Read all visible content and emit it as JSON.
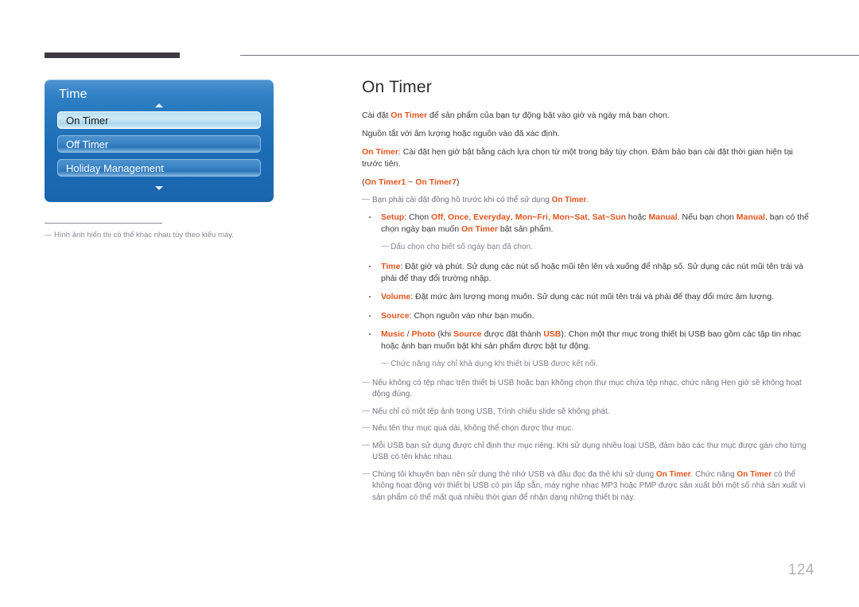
{
  "page": {
    "number": "124",
    "heading": "On Timer"
  },
  "osd": {
    "title": "Time",
    "up_arrow_icon": "chevron-up-icon",
    "down_arrow_icon": "chevron-down-icon",
    "items": [
      {
        "label": "On Timer",
        "selected": true
      },
      {
        "label": "Off Timer",
        "selected": false
      },
      {
        "label": "Holiday Management",
        "selected": false
      }
    ],
    "caption": {
      "dash": "—",
      "text": "Hình ảnh hiển thị có thể khác nhau tùy theo kiểu máy."
    }
  },
  "content": {
    "intro": [
      {
        "segments": [
          {
            "t": "Cài đặt ",
            "style": "plain"
          },
          {
            "t": "On Timer",
            "style": "orange"
          },
          {
            "t": " để sản phẩm của bạn tự động bật vào giờ và ngày mà bạn chọn.",
            "style": "plain"
          }
        ]
      },
      {
        "segments": [
          {
            "t": "Nguồn tắt với âm lượng hoặc nguồn vào đã xác định.",
            "style": "plain"
          }
        ]
      },
      {
        "segments": [
          {
            "t": "On Timer",
            "style": "orange"
          },
          {
            "t": ": Cài đặt hẹn giờ bật bằng cách lựa chọn từ một trong bảy tùy chọn. Đảm bảo bạn cài đặt thời gian hiện tại trước tiên.",
            "style": "plain"
          }
        ]
      },
      {
        "segments": [
          {
            "t": "(",
            "style": "plain"
          },
          {
            "t": "On Timer1",
            "style": "orange"
          },
          {
            "t": " ~ ",
            "style": "plain"
          },
          {
            "t": "On Timer7",
            "style": "orange"
          },
          {
            "t": ")",
            "style": "plain"
          }
        ]
      }
    ],
    "note_clock": {
      "dash": "—",
      "segments": [
        {
          "t": "Bạn phải cài đặt đồng hồ trước khi có thể sử dụng ",
          "style": "plain"
        },
        {
          "t": "On Timer",
          "style": "orange"
        },
        {
          "t": ".",
          "style": "plain"
        }
      ]
    },
    "bullets": [
      {
        "name": "bullet-setup",
        "segments": [
          {
            "t": "Setup",
            "style": "orange"
          },
          {
            "t": ": Chọn ",
            "style": "plain"
          },
          {
            "t": "Off",
            "style": "orange"
          },
          {
            "t": ", ",
            "style": "plain"
          },
          {
            "t": "Once",
            "style": "orange"
          },
          {
            "t": ", ",
            "style": "plain"
          },
          {
            "t": "Everyday",
            "style": "orange"
          },
          {
            "t": ", ",
            "style": "plain"
          },
          {
            "t": "Mon~Fri",
            "style": "orange"
          },
          {
            "t": ", ",
            "style": "plain"
          },
          {
            "t": "Mon~Sat",
            "style": "orange"
          },
          {
            "t": ", ",
            "style": "plain"
          },
          {
            "t": "Sat~Sun",
            "style": "orange"
          },
          {
            "t": " hoặc ",
            "style": "plain"
          },
          {
            "t": "Manual",
            "style": "orange"
          },
          {
            "t": ". Nếu bạn chọn ",
            "style": "plain"
          },
          {
            "t": "Manual",
            "style": "orange"
          },
          {
            "t": ", bạn có thể chọn ngày bạn muốn ",
            "style": "plain"
          },
          {
            "t": "On Timer",
            "style": "orange"
          },
          {
            "t": " bật sản phẩm.",
            "style": "plain"
          }
        ],
        "sub_note": {
          "dash": "—",
          "text": "Dấu chọn cho biết số ngày bạn đã chọn."
        }
      },
      {
        "name": "bullet-time",
        "segments": [
          {
            "t": "Time",
            "style": "orange"
          },
          {
            "t": ": Đặt giờ và phút. Sử dụng các nút số hoặc mũi tên lên và xuống để nhập số. Sử dụng các nút mũi tên trái và phải để thay đổi trường nhập.",
            "style": "plain"
          }
        ]
      },
      {
        "name": "bullet-volume",
        "segments": [
          {
            "t": "Volume",
            "style": "orange"
          },
          {
            "t": ": Đặt mức âm lượng mong muốn. Sử dụng các nút mũi tên trái và phải để thay đổi mức âm lượng.",
            "style": "plain"
          }
        ]
      },
      {
        "name": "bullet-source",
        "segments": [
          {
            "t": "Source",
            "style": "orange"
          },
          {
            "t": ": Chọn nguồn vào như bạn muốn.",
            "style": "plain"
          }
        ]
      },
      {
        "name": "bullet-music-photo",
        "segments": [
          {
            "t": "Music",
            "style": "orange"
          },
          {
            "t": " / ",
            "style": "plain"
          },
          {
            "t": "Photo",
            "style": "orange"
          },
          {
            "t": " (khi ",
            "style": "plain"
          },
          {
            "t": "Source",
            "style": "orange"
          },
          {
            "t": " được đặt thành ",
            "style": "plain"
          },
          {
            "t": "USB",
            "style": "orange"
          },
          {
            "t": "): Chọn một thư mục trong thiết bị USB bao gồm các tập tin nhạc hoặc ảnh bạn muốn bật khi sản phẩm được bật tự động.",
            "style": "plain"
          }
        ],
        "sub_note": {
          "dash": "—",
          "text": "Chức năng này chỉ khả dụng khi thiết bị USB được kết nối."
        }
      }
    ],
    "footer_notes": [
      {
        "name": "note-no-music-file",
        "dash": "—",
        "segments": [
          {
            "t": "Nếu không có tệp nhạc trên thiết bị USB hoặc bạn không chọn thư mục chứa tệp nhạc, chức năng Hẹn giờ sẽ không hoạt động đúng.",
            "style": "plain"
          }
        ]
      },
      {
        "name": "note-single-photo",
        "dash": "—",
        "segments": [
          {
            "t": "Nếu chỉ có một tệp ảnh trong USB, Trình chiếu slide sẽ không phát.",
            "style": "plain"
          }
        ]
      },
      {
        "name": "note-folder-name-long",
        "dash": "—",
        "segments": [
          {
            "t": "Nếu tên thư mục quá dài, không thể chọn được thư mục.",
            "style": "plain"
          }
        ]
      },
      {
        "name": "note-folder-per-usb",
        "dash": "—",
        "segments": [
          {
            "t": "Mỗi USB bạn sử dụng được chỉ định thư mục riêng. Khi sử dụng nhiều loại USB, đảm bảo các thư mục được gán cho từng USB có tên khác nhau.",
            "style": "plain"
          }
        ]
      },
      {
        "name": "note-memory-card",
        "dash": "—",
        "segments": [
          {
            "t": "Chúng tôi khuyên bạn nên sử dụng thẻ nhớ USB và đầu đọc đa thẻ khi sử dụng ",
            "style": "plain"
          },
          {
            "t": "On Timer",
            "style": "orange"
          },
          {
            "t": ". Chức năng ",
            "style": "plain"
          },
          {
            "t": "On Timer",
            "style": "orange"
          },
          {
            "t": " có thể không hoạt động với thiết bị USB có pin lắp sẵn, máy nghe nhạc MP3 hoặc PMP được sản xuất bởi một số nhà sản xuất vì sản phẩm có thể mất quá nhiều thời gian để nhận dạng những thiết bị này.",
            "style": "plain"
          }
        ]
      }
    ]
  },
  "colors": {
    "accent_orange": "#e3551f",
    "osd_blue": "#1c6cb6",
    "note_gray": "#77747f",
    "page_number_gray": "#b4b1ba"
  }
}
